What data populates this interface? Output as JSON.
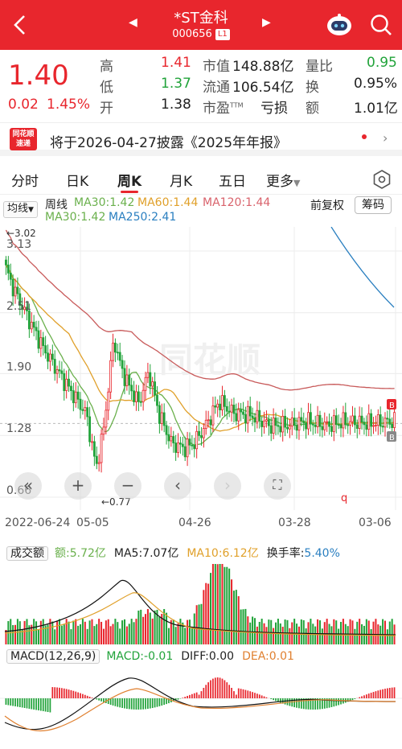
{
  "header": {
    "name": "*ST金科",
    "code": "000656",
    "level_tag": "L1"
  },
  "quote": {
    "price": "1.40",
    "change": "0.02",
    "change_pct": "1.45%",
    "high_label": "高",
    "high": "1.41",
    "low_label": "低",
    "low": "1.37",
    "open_label": "开",
    "open": "1.38",
    "mktcap_label": "市值",
    "mktcap": "148.88亿",
    "float_label": "流通",
    "float": "106.54亿",
    "pe_label": "市盈",
    "pe_sup": "TTM",
    "pe": "亏损",
    "volratio_label": "量比",
    "volratio": "0.95",
    "turnover_label": "换",
    "turnover": "0.95%",
    "amount_label": "额",
    "amount": "1.01亿"
  },
  "notice": {
    "logo_line1": "同花顺",
    "logo_line2": "速递",
    "text": "将于2026-04-27披露《2025年年报》"
  },
  "tabs": [
    "分时",
    "日K",
    "周K",
    "月K",
    "五日",
    "更多"
  ],
  "legend": {
    "avg_select": "均线",
    "period": "周线",
    "ma30_a": "MA30:1.42",
    "ma60": "MA60:1.44",
    "ma120": "MA120:1.44",
    "ma30_b": "MA30:1.42",
    "ma250": "MA250:2.41",
    "adjust": "前复权",
    "chip": "筹码"
  },
  "chart_data": {
    "type": "candlestick",
    "y_axis_labels": [
      "3.13",
      "2.51",
      "1.90",
      "1.28",
      "0.66"
    ],
    "ylim": [
      0.66,
      3.13
    ],
    "annotations": {
      "max": "3.02",
      "min": "0.77",
      "watermark": "同花顺",
      "b_marker": "B",
      "q_marker": "q"
    },
    "x_tick_labels": [
      "2022-06-24",
      "05-05",
      "04-26",
      "03-28",
      "03-06"
    ],
    "candles": [],
    "colors": {
      "up": "#e8262d",
      "down": "#21a33a",
      "ma30": "#e0a02a",
      "ma60": "#e8a0b4",
      "ma120": "#c85a5a",
      "ma250": "#2a7fc0",
      "ma30b": "#6ab04c"
    }
  },
  "volume": {
    "selector": "成交额",
    "amount": "额:5.72亿",
    "ma5": "MA5:7.07亿",
    "ma10": "MA10:6.12亿",
    "turnover_label": "换手率:",
    "turnover": "5.40%"
  },
  "macd": {
    "selector": "MACD(12,26,9)",
    "macd": "MACD:-0.01",
    "diff": "DIFF:0.00",
    "dea": "DEA:0.01"
  }
}
